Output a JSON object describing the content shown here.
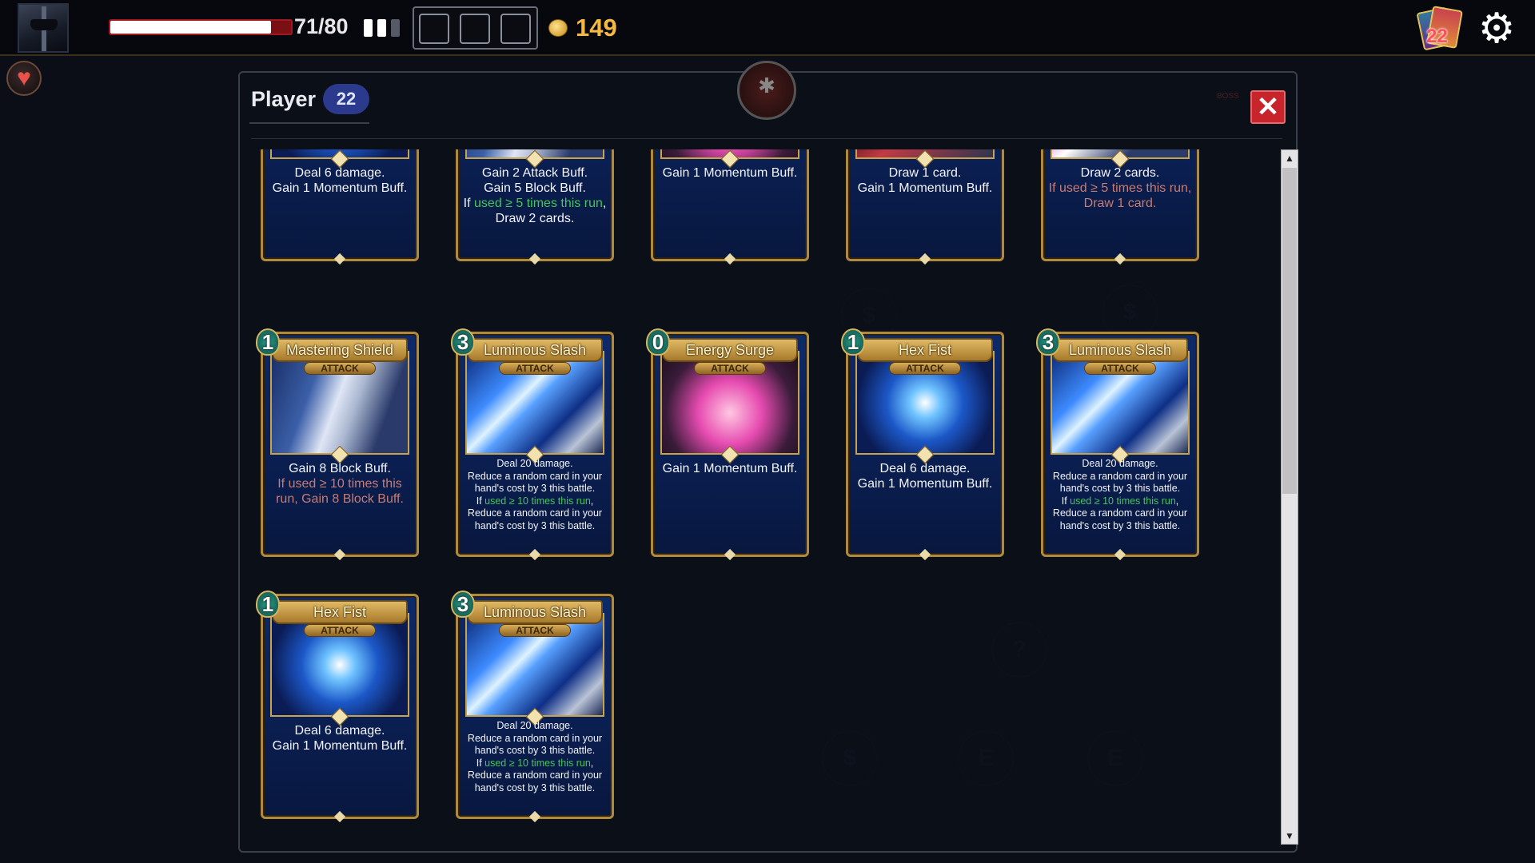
{
  "hud": {
    "hp_text": "71/80",
    "hp_fraction": 0.8875,
    "gold": "149",
    "deck_count": "22",
    "pips": [
      true,
      true,
      false
    ]
  },
  "panel": {
    "title": "Player",
    "count": "22",
    "close_glyph": "✕",
    "boss_label": "BOSS"
  },
  "map_nodes": [
    "$",
    "$",
    "?",
    "$",
    "E",
    "E"
  ],
  "cards": [
    {
      "row": 0,
      "col": 0,
      "cost": "",
      "name": "",
      "type": "",
      "art": "blue",
      "desc": [
        {
          "t": "Deal 6 damage."
        },
        {
          "t": "Gain 1 Momentum Buff."
        }
      ]
    },
    {
      "row": 0,
      "col": 1,
      "cost": "",
      "name": "",
      "type": "",
      "art": "shield",
      "desc": [
        {
          "t": "Gain 2 Attack Buff."
        },
        {
          "t": "Gain 5 Block Buff."
        },
        {
          "t": "If ",
          "hl": "used ≥ 5 times this run",
          ",": ""
        },
        {
          "t": ", Draw 2 cards."
        }
      ]
    },
    {
      "row": 0,
      "col": 2,
      "cost": "",
      "name": "",
      "type": "",
      "art": "pink",
      "desc": [
        {
          "t": "Gain 1 Momentum Buff."
        }
      ]
    },
    {
      "row": 0,
      "col": 3,
      "cost": "",
      "name": "",
      "type": "",
      "art": "red",
      "desc": [
        {
          "t": "Draw 1 card."
        },
        {
          "t": "Gain 1 Momentum Buff."
        }
      ]
    },
    {
      "row": 0,
      "col": 4,
      "cost": "",
      "name": "",
      "type": "",
      "art": "bow",
      "desc": [
        {
          "t": "Draw 2 cards."
        },
        {
          "cond": "If used ≥ 5 times this run, Draw 1 card."
        }
      ]
    },
    {
      "row": 1,
      "col": 0,
      "cost": "1",
      "name": "Mastering Shield",
      "type": "ATTACK",
      "art": "shield",
      "desc": [
        {
          "t": "Gain 8 Block Buff."
        },
        {
          "cond": "If used ≥ 10 times this run, Gain 8 Block Buff."
        }
      ]
    },
    {
      "row": 1,
      "col": 1,
      "cost": "3",
      "name": "Luminous Slash",
      "type": "ATTACK",
      "art": "slash",
      "small": true,
      "desc": [
        {
          "t": "Deal 20 damage."
        },
        {
          "t": "Reduce a random card in your hand's cost by 3 this battle."
        },
        {
          "t": "If ",
          "hl": "used ≥ 10 times this run"
        },
        {
          "t": ", Reduce a random card in your hand's cost by 3 this battle."
        }
      ]
    },
    {
      "row": 1,
      "col": 2,
      "cost": "0",
      "name": "Energy Surge",
      "type": "ATTACK",
      "art": "pink",
      "desc": [
        {
          "t": "Gain 1 Momentum Buff."
        }
      ]
    },
    {
      "row": 1,
      "col": 3,
      "cost": "1",
      "name": "Hex Fist",
      "type": "ATTACK",
      "art": "blue",
      "desc": [
        {
          "t": "Deal 6 damage."
        },
        {
          "t": "Gain 1 Momentum Buff."
        }
      ]
    },
    {
      "row": 1,
      "col": 4,
      "cost": "3",
      "name": "Luminous Slash",
      "type": "ATTACK",
      "art": "slash",
      "small": true,
      "desc": [
        {
          "t": "Deal 20 damage."
        },
        {
          "t": "Reduce a random card in your hand's cost by 3 this battle."
        },
        {
          "t": "If ",
          "hl": "used ≥ 10 times this run"
        },
        {
          "t": ", Reduce a random card in your hand's cost by 3 this battle."
        }
      ]
    },
    {
      "row": 2,
      "col": 0,
      "cost": "1",
      "name": "Hex Fist",
      "type": "ATTACK",
      "art": "blue",
      "desc": [
        {
          "t": "Deal 6 damage."
        },
        {
          "t": "Gain 1 Momentum Buff."
        }
      ]
    },
    {
      "row": 2,
      "col": 1,
      "cost": "3",
      "name": "Luminous Slash",
      "type": "ATTACK",
      "art": "slash",
      "small": true,
      "desc": [
        {
          "t": "Deal 20 damage."
        },
        {
          "t": "Reduce a random card in your hand's cost by 3 this battle."
        },
        {
          "t": "If ",
          "hl": "used ≥ 10 times this run"
        },
        {
          "t": ", Reduce a random card in your hand's cost by 3 this battle."
        }
      ]
    }
  ],
  "colors": {
    "hp": "#ffffff",
    "gold": "#f5b942",
    "close": "#c8242b",
    "highlight": "#47c45b",
    "condition": "#c77c74",
    "badge": "#2b3a8c"
  },
  "icons": {
    "settings": "gear-icon",
    "deck": "card-deck-icon",
    "relic": "heart-relic-icon",
    "gold": "coin-icon"
  }
}
